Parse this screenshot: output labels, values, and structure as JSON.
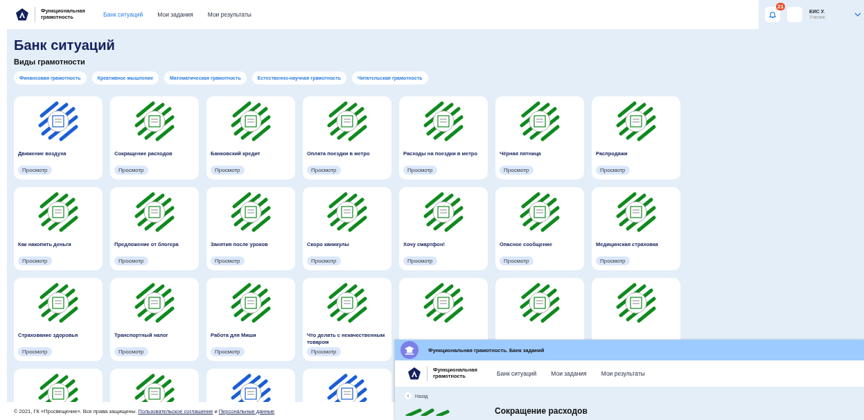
{
  "header": {
    "brand": "Функциональная грамотность",
    "nav": [
      {
        "label": "Банк ситуаций",
        "selected": true
      },
      {
        "label": "Мои задания",
        "selected": false
      },
      {
        "label": "Мои результаты",
        "selected": false
      }
    ],
    "notifications": "21",
    "user": {
      "name": "ЕИС У.",
      "role": "Ученик"
    }
  },
  "page": {
    "title": "Банк ситуаций",
    "section_title": "Виды грамотности",
    "categories": [
      "Финансовая грамотность",
      "Креативное мышление",
      "Математическая грамотность",
      "Естественно-научная грамотность",
      "Читательская грамотность"
    ],
    "situations": [
      {
        "title": "Движение воздуха",
        "color": "#1a5fd6",
        "button": "Просмотр"
      },
      {
        "title": "Сокращение расходов",
        "color": "#0f8a1e",
        "button": "Просмотр"
      },
      {
        "title": "Банковский кредит",
        "color": "#0f8a1e",
        "button": "Просмотр"
      },
      {
        "title": "Оплата поездки в метро",
        "color": "#0f8a1e",
        "button": "Просмотр"
      },
      {
        "title": "Расходы на поездки в метро",
        "color": "#0f8a1e",
        "button": "Просмотр"
      },
      {
        "title": "Чёрная пятница",
        "color": "#0f8a1e",
        "button": "Просмотр"
      },
      {
        "title": "Распродажи",
        "color": "#0f8a1e",
        "button": "Просмотр"
      },
      {
        "title": "Как накопить деньги",
        "color": "#0f8a1e",
        "button": "Просмотр"
      },
      {
        "title": "Предложение от блогера",
        "color": "#0f8a1e",
        "button": "Просмотр"
      },
      {
        "title": "Занятия после уроков",
        "color": "#0f8a1e",
        "button": "Просмотр"
      },
      {
        "title": "Скоро каникулы",
        "color": "#0f8a1e",
        "button": "Просмотр"
      },
      {
        "title": "Хочу смартфон!",
        "color": "#0f8a1e",
        "button": "Просмотр"
      },
      {
        "title": "Опасное сообщение",
        "color": "#0f8a1e",
        "button": "Просмотр"
      },
      {
        "title": "Медицинская страховка",
        "color": "#0f8a1e",
        "button": "Просмотр"
      },
      {
        "title": "Страхование здоровья",
        "color": "#0f8a1e",
        "button": "Просмотр"
      },
      {
        "title": "Транспортный налог",
        "color": "#0f8a1e",
        "button": "Просмотр"
      },
      {
        "title": "Работа для Миши",
        "color": "#0f8a1e",
        "button": "Просмотр"
      },
      {
        "title": "Что делать с некачественным товаром",
        "color": "#0f8a1e",
        "button": "Просмотр"
      },
      {
        "color": "#0f8a1e"
      },
      {
        "color": "#0f8a1e"
      },
      {
        "color": "#0f8a1e"
      },
      {
        "color": "#0f8a1e"
      },
      {
        "color": "#0f8a1e"
      },
      {
        "color": "#1a5fd6"
      },
      {
        "color": "#1a5fd6"
      }
    ]
  },
  "footer": {
    "text": "© 2021, ГК «Просвещение». Все права защищены.",
    "links": [
      "Пользовательское соглашение",
      "Персональные данные"
    ],
    "conjunction": "и"
  },
  "overlay_window": {
    "title": "Функциональная грамотность. Банк заданий",
    "brand": "Функциональная грамотность",
    "nav": [
      "Банк ситуаций",
      "Мои задания",
      "Мои результаты"
    ],
    "back": "Назад",
    "heading": "Сокращение расходов"
  }
}
